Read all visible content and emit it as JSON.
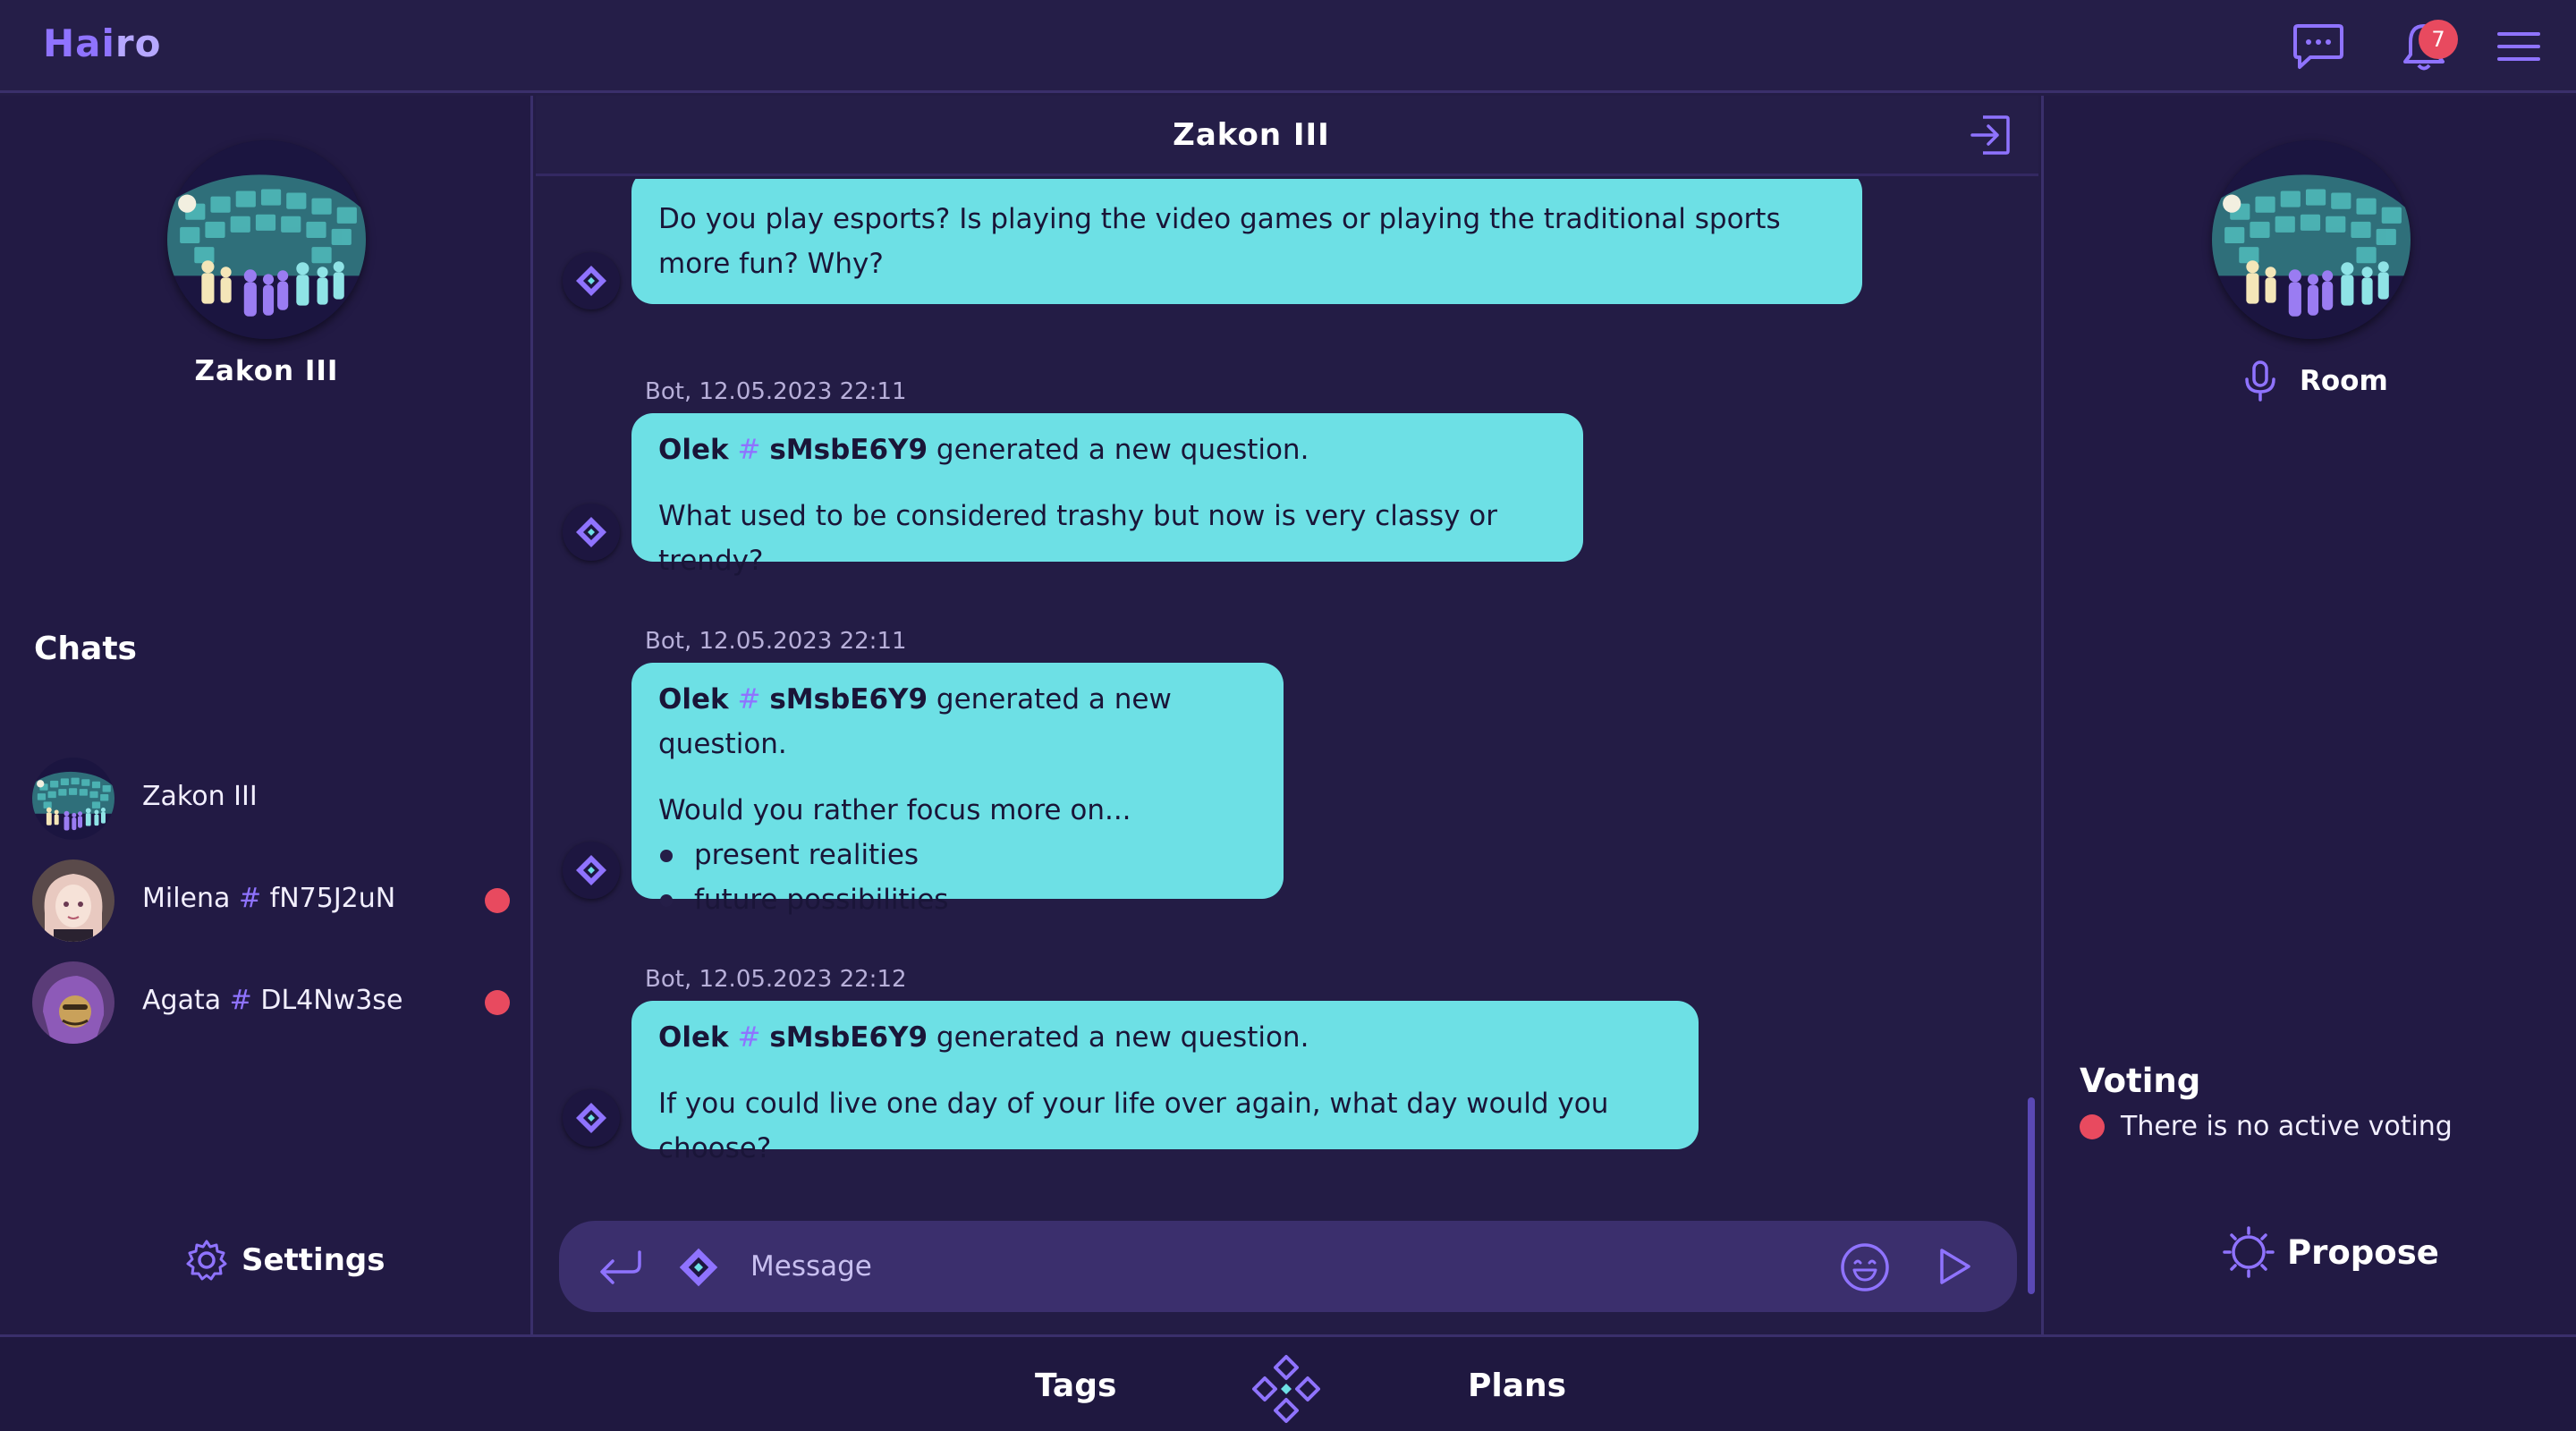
{
  "app": {
    "logo_part1": "Hai",
    "logo_part2": "ro"
  },
  "topbar": {
    "notifications_count": "7"
  },
  "left": {
    "room_title": "Zakon III",
    "chats_heading": "Chats",
    "chats": [
      {
        "name": "Zakon III",
        "tag": "",
        "unread": false
      },
      {
        "name": "Milena",
        "tag": "fN75J2uN",
        "unread": true
      },
      {
        "name": "Agata",
        "tag": "DL4Nw3se",
        "unread": true
      }
    ],
    "settings_label": "Settings"
  },
  "chat": {
    "title": "Zakon III",
    "messages": [
      {
        "text": "Do you play esports? Is playing the video games or playing the traditional sports more fun? Why?"
      },
      {
        "timestamp": "Bot, 12.05.2023 22:11",
        "author": "Olek",
        "tag": "sMsbE6Y9",
        "action": "generated a new question.",
        "question": "What used to be considered trashy but now is very classy or trendy?"
      },
      {
        "timestamp": "Bot, 12.05.2023 22:11",
        "author": "Olek",
        "tag": "sMsbE6Y9",
        "action": "generated a new question.",
        "question": "Would you rather focus more on...",
        "options": [
          "present realities",
          "future possibilities"
        ]
      },
      {
        "timestamp": "Bot, 12.05.2023 22:12",
        "author": "Olek",
        "tag": "sMsbE6Y9",
        "action": "generated a new question.",
        "question": "If you could live one day of your life over again, what day would you choose?"
      }
    ],
    "composer_placeholder": "Message",
    "hash_symbol": "#"
  },
  "right": {
    "room_label": "Room",
    "voting_title": "Voting",
    "voting_status": "There is no active voting",
    "propose_label": "Propose"
  },
  "bottom": {
    "tab_tags": "Tags",
    "tab_plans": "Plans"
  },
  "colors": {
    "accent": "#8f73ff",
    "bubble": "#6de0e5",
    "alert": "#e84a5f",
    "bg": "#231c45"
  },
  "icons": [
    "chat-icon",
    "bell-icon",
    "menu-icon",
    "exit-icon",
    "gear-icon",
    "reply-icon",
    "bot-diamond-icon",
    "emoji-icon",
    "send-icon",
    "microphone-icon",
    "propose-icon",
    "hairo-logo-icon"
  ]
}
